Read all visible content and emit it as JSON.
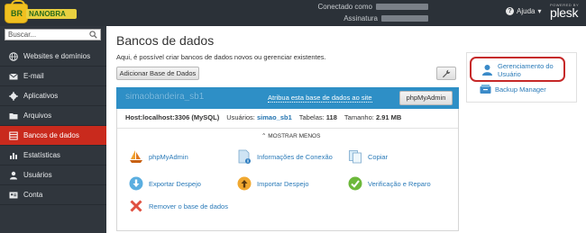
{
  "header": {
    "logo_text": "BR",
    "logo_banner": "NANOBRA",
    "connected_label": "Conectado como",
    "subscription_label": "Assinatura",
    "help_label": "Ajuda",
    "powered_by": "POWERED BY",
    "brand": "plesk"
  },
  "sidebar": {
    "search_placeholder": "Buscar...",
    "items": [
      {
        "label": "Websites e domínios",
        "icon": "globe-icon"
      },
      {
        "label": "E-mail",
        "icon": "envelope-icon"
      },
      {
        "label": "Aplicativos",
        "icon": "gear-icon"
      },
      {
        "label": "Arquivos",
        "icon": "folder-icon"
      },
      {
        "label": "Bancos de dados",
        "icon": "database-icon",
        "active": true
      },
      {
        "label": "Estatísticas",
        "icon": "bar-chart-icon"
      },
      {
        "label": "Usuários",
        "icon": "user-icon"
      },
      {
        "label": "Conta",
        "icon": "id-card-icon"
      }
    ]
  },
  "main": {
    "title": "Bancos de dados",
    "subtitle": "Aqui, é possível criar bancos de dados novos ou gerenciar existentes.",
    "add_button": "Adicionar Base de Dados",
    "database": {
      "name": "simaobandeira_sb1",
      "assign_link": "Atribua esta base de dados ao site",
      "phpmyadmin_button": "phpMyAdmin",
      "host_label": "Host:",
      "host_value": "localhost:3306 (MySQL)",
      "users_label": "Usuários:",
      "users_value": "simao_sb1",
      "tables_label": "Tabelas:",
      "tables_value": "118",
      "size_label": "Tamanho:",
      "size_value": "2.91 MB",
      "toggle_label": "MOSTRAR MENOS",
      "actions": [
        {
          "label": "phpMyAdmin",
          "icon": "sailboat-icon"
        },
        {
          "label": "Informações de Conexão",
          "icon": "info-document-icon"
        },
        {
          "label": "Copiar",
          "icon": "copy-icon"
        },
        {
          "label": "Exportar Despejo",
          "icon": "download-icon"
        },
        {
          "label": "Importar Despejo",
          "icon": "upload-icon"
        },
        {
          "label": "Verificação e Reparo",
          "icon": "checkmark-icon"
        },
        {
          "label": "Remover o base de dados",
          "icon": "remove-icon"
        }
      ]
    }
  },
  "right_panel": {
    "user_management": "Gerenciamento do Usuário",
    "user_management_line1": "Gerenciamento do",
    "user_management_line2": "Usuário",
    "backup_manager": "Backup Manager"
  },
  "colors": {
    "topbar": "#2b3138",
    "sidebar": "#30363d",
    "active_item": "#c92a1d",
    "db_bar": "#2e8fc6",
    "link": "#2a7ab8",
    "highlight_circle": "#c62828"
  }
}
